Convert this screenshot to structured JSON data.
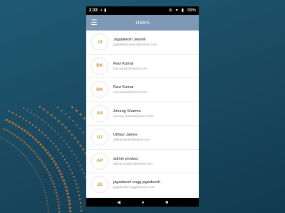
{
  "status_bar": {
    "time": "2:33",
    "battery": "99%"
  },
  "app_bar": {
    "title": "Users"
  },
  "users": [
    {
      "initials": "JJ",
      "name": "Jagadeesh Jeevoli",
      "email": "jagadeesh.jeevoli@avenir.com"
    },
    {
      "initials": "RK",
      "name": "Ravi Kumar",
      "email": "ravi.kumar@avenir.com"
    },
    {
      "initials": "RK",
      "name": "Ravi Kumar",
      "email": "ravi.kumar@avenir.com"
    },
    {
      "initials": "AS",
      "name": "Anurag Sharma",
      "email": "anurag.sharma@avenir.com"
    },
    {
      "initials": "UJ",
      "name": "Uthkar James",
      "email": "uthkar.james@avenir.com"
    },
    {
      "initials": "AP",
      "name": "admin product",
      "email": "admin.product@avenir.com"
    },
    {
      "initials": "JE",
      "name": "jagadeesh engg jagadeesh",
      "email": "jagadeesh.engg@avenir.com"
    }
  ],
  "colors": {
    "app_bar": "#7f98b5",
    "initials": "#c8963a",
    "background": "#1a4b63",
    "dots": "#e07a2e"
  },
  "icons": {
    "menu": "hamburger-menu-icon",
    "back": "back-triangle-icon",
    "home": "home-circle-icon",
    "recents": "recents-square-icon"
  }
}
